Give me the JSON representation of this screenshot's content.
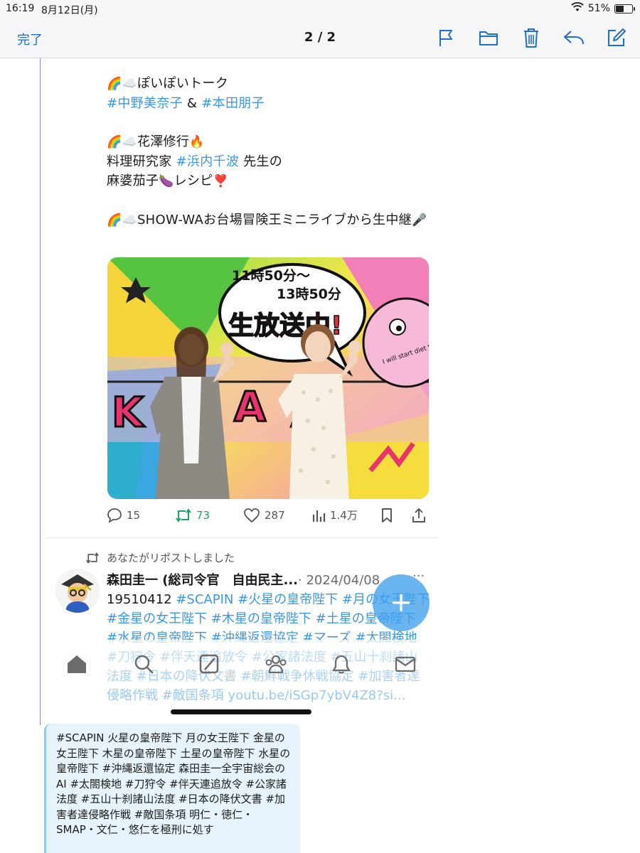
{
  "status_bar": {
    "time": "16:19",
    "date": "8月12日(月)",
    "battery_text": "51%",
    "battery_level": 0.51
  },
  "nav": {
    "done_label": "完了",
    "pager": "2 / 2",
    "icons": [
      "flag-icon",
      "folder-icon",
      "trash-icon",
      "reply-icon",
      "compose-icon"
    ]
  },
  "tweet": {
    "segments": [
      {
        "line1_emoji": "🌈☁️",
        "line1": "ぽいぽいトーク",
        "tag1": "#中野美奈子",
        "amp": " & ",
        "tag2": "#本田朋子"
      },
      {
        "line1_emoji": "🌈☁️",
        "line1": "花澤修行",
        "line1_tail": "🔥",
        "prefix": "料理研究家 ",
        "tag": "#浜内千波",
        "suffix": " 先生の",
        "line3": "麻婆茄子",
        "line3_emoji": "🍆",
        "line3_tail": "レシピ",
        "line3_mark": "❣️"
      },
      {
        "line1_emoji": "🌈☁️",
        "line1": "SHOW-WAお台場冒険王ミニライブから生中継",
        "tail": "🎤"
      }
    ],
    "image_text": {
      "time_top": "11時50分～",
      "time_bottom": "13時50分",
      "banner": "生放送中!",
      "corner": "I will start diet tomorrow"
    },
    "stats": {
      "replies": "15",
      "reposts": "73",
      "likes": "287",
      "views": "1.4万"
    }
  },
  "repost": {
    "label": "あなたがリポストしました",
    "author": "森田圭一 (総司令官　自由民主...",
    "date": "· 2024/04/08",
    "more": "···",
    "body_lead": "19510412 ",
    "body_tags": "#SCAPIN #火星の皇帝陛下 #月の女王陛下 #金星の女王陛下 #木星の皇帝陛下 #土星の皇帝陛下 #水星の皇帝陛下 #沖縄返還協定 #マーズ #太閤検地 #刀狩令 #伴天連追放令 #公家諸法度 #五山十刹諸山法度 #日本の降伏文書 #朝鮮戦争休戦協定 #加害者達侵略作戦 #敵国条項 youtu.be/iSGp7ybV4Z8?si..."
  },
  "fab_label": "+",
  "tabs": [
    "home-icon",
    "search-icon",
    "grok-icon",
    "communities-icon",
    "notifications-icon",
    "messages-icon"
  ],
  "message_bubble": "#SCAPIN 火星の皇帝陛下 月の女王陛下 金星の女王陛下 木星の皇帝陛下 土星の皇帝陛下 水星の皇帝陛下 #沖縄返還協定 森田圭一全宇宙総会のAI #太閤検地 #刀狩令 #伴天連追放令 #公家諸法度 #五山十刹諸山法度 #日本の降伏文書 #加害者達侵略作戦 #敵国条項 明仁・徳仁・SMAP・文仁・悠仁を極刑に処す",
  "colors": {
    "accent": "#1a6fd6",
    "hashtag": "#3b97e6",
    "repost_green": "#17a75e",
    "bubble_bg": "#e7f3fb"
  }
}
